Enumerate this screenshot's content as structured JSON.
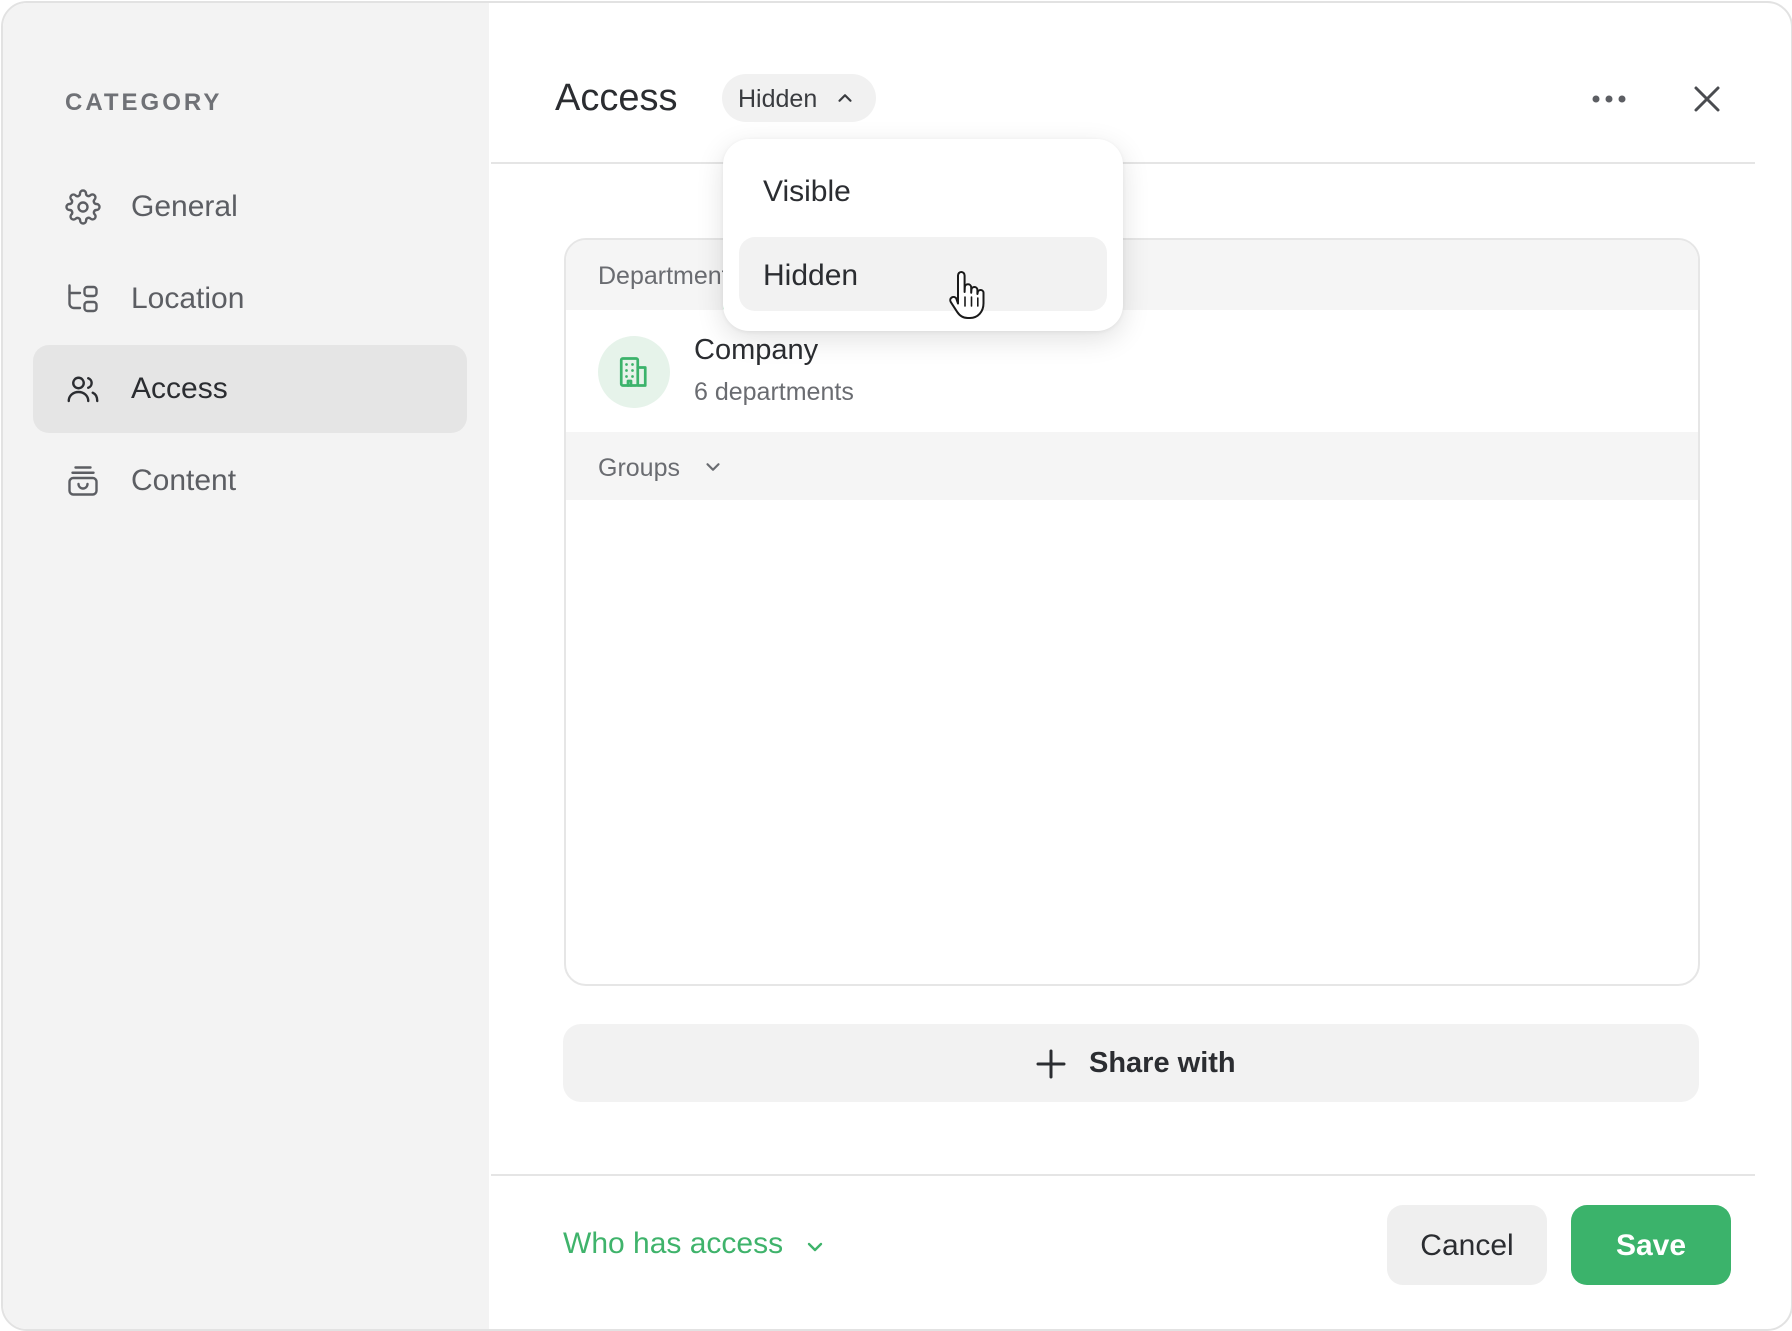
{
  "sidebar": {
    "category_title": "CATEGORY",
    "items": [
      {
        "label": "General",
        "icon": "gear-icon"
      },
      {
        "label": "Location",
        "icon": "location-tree-icon"
      },
      {
        "label": "Access",
        "icon": "users-icon",
        "active": true
      },
      {
        "label": "Content",
        "icon": "content-box-icon"
      }
    ]
  },
  "header": {
    "title": "Access",
    "visibility_value": "Hidden"
  },
  "dropdown": {
    "options": [
      "Visible",
      "Hidden"
    ],
    "selected": "Hidden"
  },
  "list": {
    "departments_header": "Departments",
    "company": {
      "name": "Company",
      "subtitle": "6 departments"
    },
    "groups_header": "Groups"
  },
  "actions": {
    "share_label": "Share with",
    "who_has_access": "Who has access",
    "cancel": "Cancel",
    "save": "Save"
  },
  "colors": {
    "accent": "#3bb36b",
    "sidebar_bg": "#f3f3f3",
    "active_item_bg": "#e5e5e5"
  }
}
